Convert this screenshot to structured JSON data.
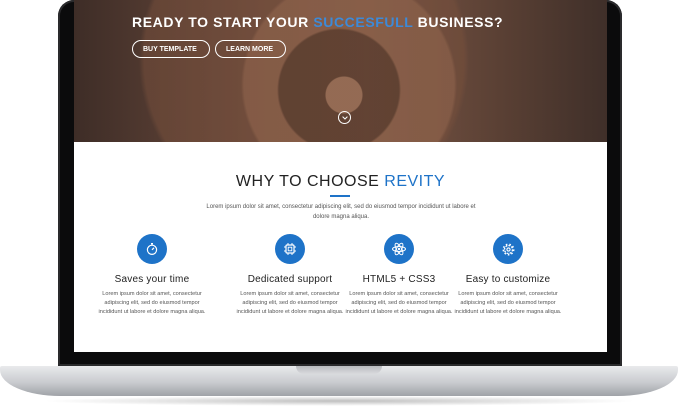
{
  "hero": {
    "title_part1": "READY TO START YOUR ",
    "title_accent": "SUCCESFULL",
    "title_part2": " BUSINESS?",
    "buy_label": "BUY TEMPLATE",
    "learn_label": "LEARN MORE"
  },
  "why": {
    "title": "WHY TO CHOOSE ",
    "title_accent": "REVITY",
    "intro": "Lorem ipsum dolor sit amet, consectetur adipiscing elit, sed do eiusmod tempor incididunt ut labore et dolore magna aliqua."
  },
  "features": [
    {
      "icon": "stopwatch-icon",
      "title": "Saves your time",
      "text": "Lorem ipsum dolor sit amet, consectetur adipiscing elit, sed do eiusmod tempor incididunt ut labore et dolore magna aliqua."
    },
    {
      "icon": "chip-icon",
      "title": "Dedicated support",
      "text": "Lorem ipsum dolor sit amet, consectetur adipiscing elit, sed do eiusmod tempor incididunt ut labore et dolore magna aliqua."
    },
    {
      "icon": "atom-icon",
      "title": "HTML5 + CSS3",
      "text": "Lorem ipsum dolor sit amet, consectetur adipiscing elit, sed do eiusmod tempor incididunt ut labore et dolore magna aliqua."
    },
    {
      "icon": "gear-icon",
      "title": "Easy to customize",
      "text": "Lorem ipsum dolor sit amet, consectetur adipiscing elit, sed do eiusmod tempor incididunt ut labore et dolore magna aliqua."
    }
  ],
  "colors": {
    "accent": "#1e73c8",
    "hero_accent": "#3d8ad8"
  }
}
